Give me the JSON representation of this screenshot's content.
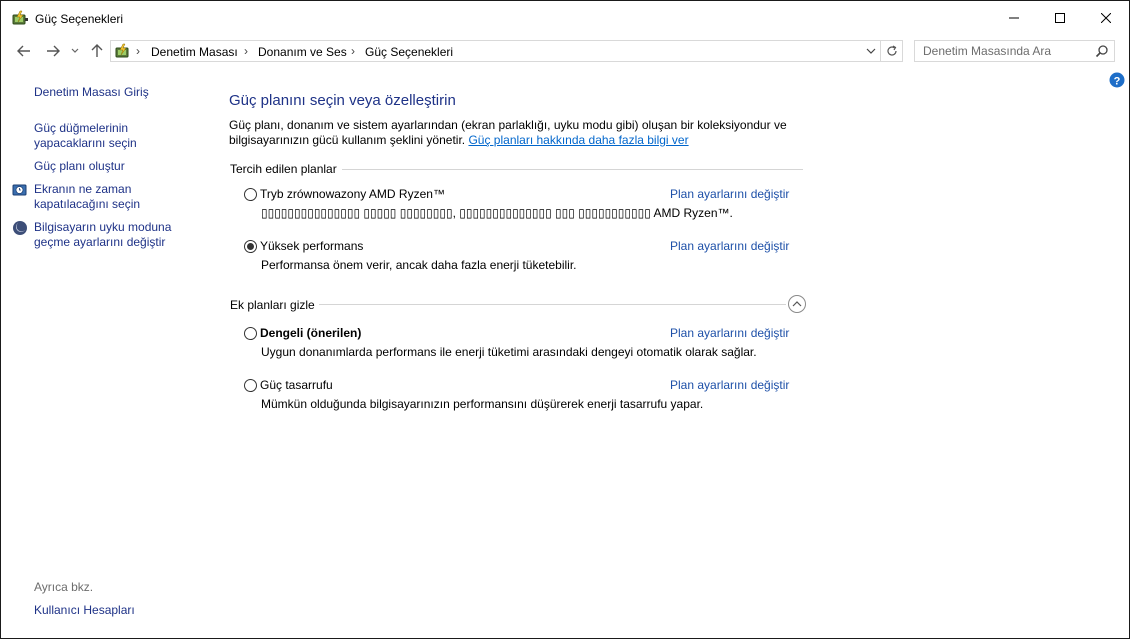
{
  "window": {
    "title": "Güç Seçenekleri"
  },
  "addressbar": {
    "crumbs": [
      "Denetim Masası",
      "Donanım ve Ses",
      "Güç Seçenekleri"
    ]
  },
  "search": {
    "placeholder": "Denetim Masasında Ara"
  },
  "sidebar": {
    "home": "Denetim Masası Giriş",
    "links": [
      "Güç düğmelerinin yapacaklarını seçin",
      "Güç planı oluştur",
      "Ekranın ne zaman kapatılacağını seçin",
      "Bilgisayarın uyku moduna geçme ayarlarını değiştir"
    ],
    "see_also_label": "Ayrıca bkz.",
    "see_also_links": [
      "Kullanıcı Hesapları"
    ]
  },
  "main": {
    "title": "Güç planını seçin veya özelleştirin",
    "description": "Güç planı, donanım ve sistem ayarlarından (ekran parlaklığı, uyku modu gibi) oluşan bir koleksiyondur ve bilgisayarınızın gücü kullanım şeklini yönetir.",
    "description_link": "Güç planları hakkında daha fazla bilgi ver",
    "preferred_heading": "Tercih edilen planlar",
    "extra_heading": "Ek planları gizle",
    "change_link": "Plan ayarlarını değiştir",
    "preferred_plans": [
      {
        "name": "Tryb zrównowazony AMD Ryzen™",
        "desc": "▯▯▯▯▯▯▯▯▯▯▯▯▯▯▯ ▯▯▯▯▯ ▯▯▯▯▯▯▯▯, ▯▯▯▯▯▯▯▯▯▯▯▯▯▯ ▯▯▯ ▯▯▯▯▯▯▯▯▯▯▯ AMD Ryzen™.",
        "checked": false
      },
      {
        "name": "Yüksek performans",
        "desc": "Performansa önem verir, ancak daha fazla enerji tüketebilir.",
        "checked": true
      }
    ],
    "extra_plans": [
      {
        "name": "Dengeli (önerilen)",
        "desc": "Uygun donanımlarda performans ile enerji tüketimi arasındaki dengeyi otomatik olarak sağlar.",
        "checked": false
      },
      {
        "name": "Güç tasarrufu",
        "desc": "Mümkün olduğunda bilgisayarınızın performansını düşürerek enerji tasarrufu yapar.",
        "checked": false
      }
    ]
  },
  "colors": {
    "link": "#1e3287",
    "accent": "#0066cc",
    "help": "#1e6ec8"
  }
}
